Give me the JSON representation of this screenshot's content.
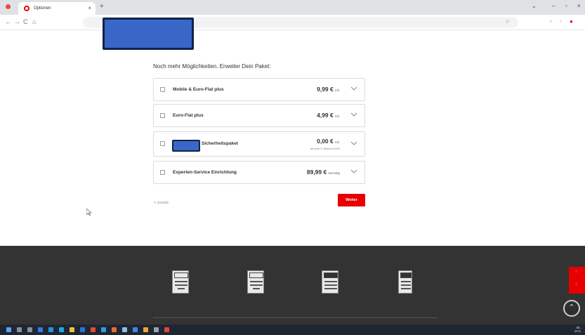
{
  "browser": {
    "tab_title": "Optionen",
    "tab_close": "×",
    "new_tab": "+",
    "window_controls": [
      "⌄",
      "–",
      "▫",
      "×"
    ],
    "nav": [
      "←",
      "→",
      "C",
      "⌂"
    ]
  },
  "page": {
    "heading": "Noch mehr Möglichkeiten. Erweiter Dein Paket:",
    "options": [
      {
        "name": "Mobile & Euro-Flat plus",
        "price": "9,99 €",
        "unit": "mtl.",
        "sub": ""
      },
      {
        "name": "Euro-Flat plus",
        "price": "4,99 €",
        "unit": "mtl.",
        "sub": ""
      },
      {
        "name": "Sicherheitspaket",
        "price": "0,00 €",
        "unit": "mtl.",
        "sub": "ab dem 3. Monat 3,99 €"
      },
      {
        "name": "Experten-Service Einrichtung",
        "price": "89,99 €",
        "unit": "einmalig",
        "sub": ""
      }
    ],
    "back_label": "< zurück",
    "next_label": "Weiter"
  },
  "footer": {
    "awards": [
      "CHIP",
      "CHIP",
      "connect",
      "Testsieger"
    ],
    "scroll_top_glyph": "⌃"
  },
  "taskbar": {
    "time": "08:..",
    "date": "10.0.."
  },
  "colors": {
    "accent_red": "#e60000",
    "footer_bg": "#333333",
    "redaction": "#3a67c7"
  }
}
